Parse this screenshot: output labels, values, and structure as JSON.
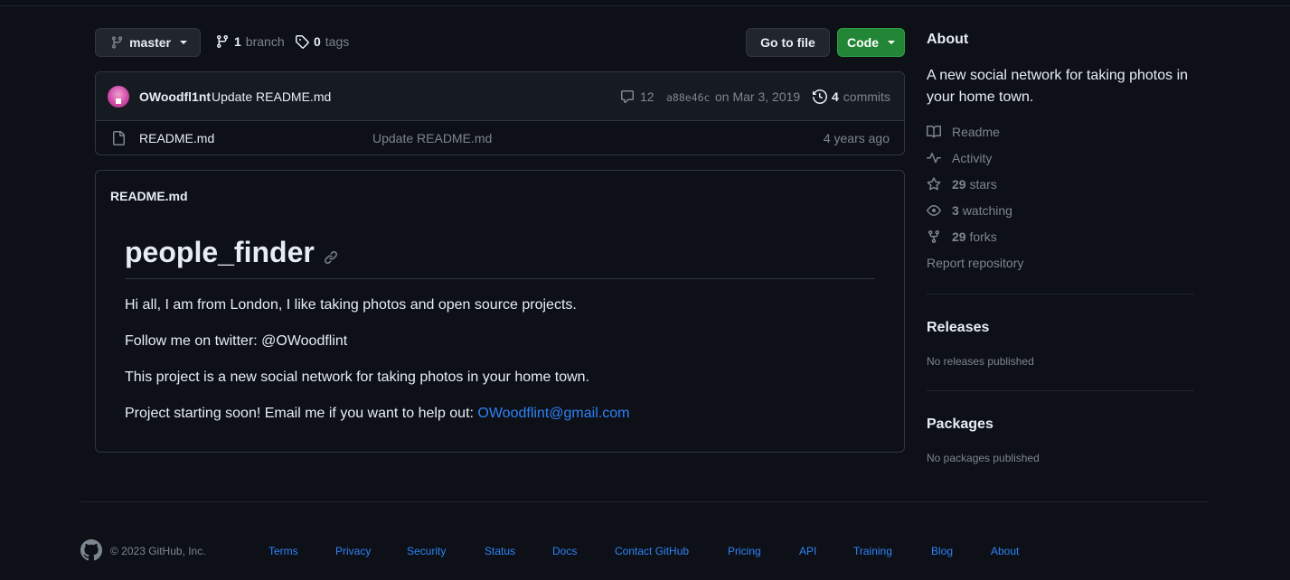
{
  "nav": {
    "branch": "master",
    "branch_count": "1",
    "branch_label": "branch",
    "tag_count": "0",
    "tag_label": "tags",
    "go_to_file": "Go to file",
    "code": "Code"
  },
  "commit": {
    "author": "OWoodfl1nt",
    "message": "Update README.md",
    "comments": "12",
    "sha": "a88e46c",
    "date": "on Mar 3, 2019",
    "count": "4",
    "count_label": "commits"
  },
  "files": [
    {
      "name": "README.md",
      "commit_message": "Update README.md",
      "age": "4 years ago"
    }
  ],
  "readme": {
    "filename": "README.md",
    "heading": "people_finder",
    "p1": "Hi all, I am from London, I like taking photos and open source projects.",
    "p2": "Follow me on twitter: @OWoodflint",
    "p3": "This project is a new social network for taking photos in your home town.",
    "p4_text": "Project starting soon! Email me if you want to help out: ",
    "p4_link": "OWoodflint@gmail.com"
  },
  "sidebar": {
    "about_heading": "About",
    "description": "A new social network for taking photos in your home town.",
    "readme": "Readme",
    "activity": "Activity",
    "stars_count": "29",
    "stars_label": "stars",
    "watching_count": "3",
    "watching_label": "watching",
    "forks_count": "29",
    "forks_label": "forks",
    "report": "Report repository",
    "releases_heading": "Releases",
    "releases_text": "No releases published",
    "packages_heading": "Packages",
    "packages_text": "No packages published"
  },
  "footer": {
    "copyright": "© 2023 GitHub, Inc.",
    "links": [
      "Terms",
      "Privacy",
      "Security",
      "Status",
      "Docs",
      "Contact GitHub",
      "Pricing",
      "API",
      "Training",
      "Blog",
      "About"
    ]
  },
  "colors": {
    "background": "#0d1117",
    "accent_link": "#2f81f7",
    "code_button": "#238636",
    "muted": "#7d8590"
  }
}
